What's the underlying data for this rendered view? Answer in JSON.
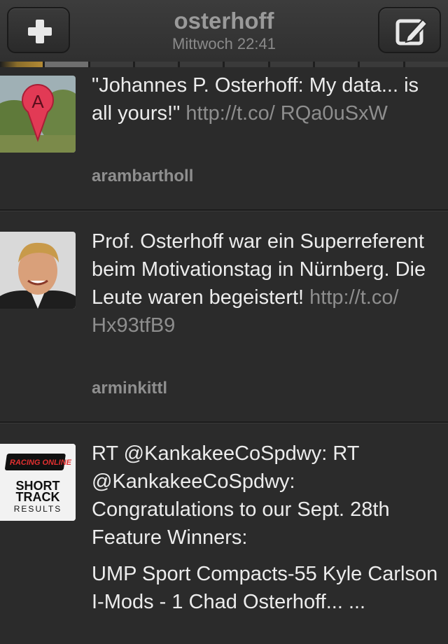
{
  "header": {
    "title": "osterhoff",
    "subtitle": "Mittwoch 22:41",
    "left_icon": "plus-icon",
    "right_icon": "compose-icon"
  },
  "tweets": [
    {
      "text": "\"Johannes P. Osterhoff: My data... is all yours!\" ",
      "link": "http://t.co/ RQa0uSxW",
      "user": "arambartholl",
      "avatar": "map-pin-avatar",
      "avatar_letter": "A"
    },
    {
      "text": "Prof. Osterhoff war ein Superreferent beim Motivationstag in Nürnberg. Die Leute waren begeistert! ",
      "link": "http://t.co/ Hx93tfB9",
      "user": "arminkittl",
      "avatar": "portrait-avatar"
    },
    {
      "text": "RT @KankakeeCoSpdwy: RT @KankakeeCoSpdwy: Congratulations to our Sept. 28th Feature Winners:",
      "text2": "UMP Sport Compacts-55 Kyle Carlson",
      "text3": "I-Mods - 1 Chad Osterhoff... ...",
      "user": "",
      "avatar": "short-track-results-logo",
      "logo_top": "RACING ONLINE",
      "logo_line1": "SHORT",
      "logo_line2": "TRACK",
      "logo_line3": "RESULTS"
    }
  ],
  "colors": {
    "background": "#2b2b2b",
    "text": "#ececec",
    "link": "#8e8e8e",
    "username": "#8f8f8f"
  }
}
